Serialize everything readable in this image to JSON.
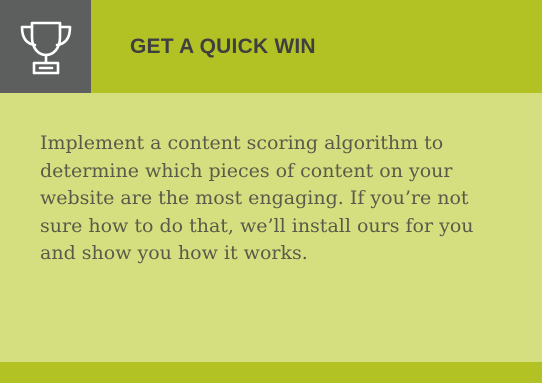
{
  "card": {
    "title": "GET A QUICK WIN",
    "icon": "trophy-icon",
    "body": "Implement a content scoring algorithm to determine which pieces of content on your website are the most engaging. If you’re not sure how to do that, we’ll install ours for you and show you how it works."
  },
  "colors": {
    "header": "#b2c224",
    "icon_box": "#5d5f5e",
    "body_background": "#d5df7f",
    "title_text": "#3f3f3f",
    "body_text": "#5a5a4a"
  }
}
